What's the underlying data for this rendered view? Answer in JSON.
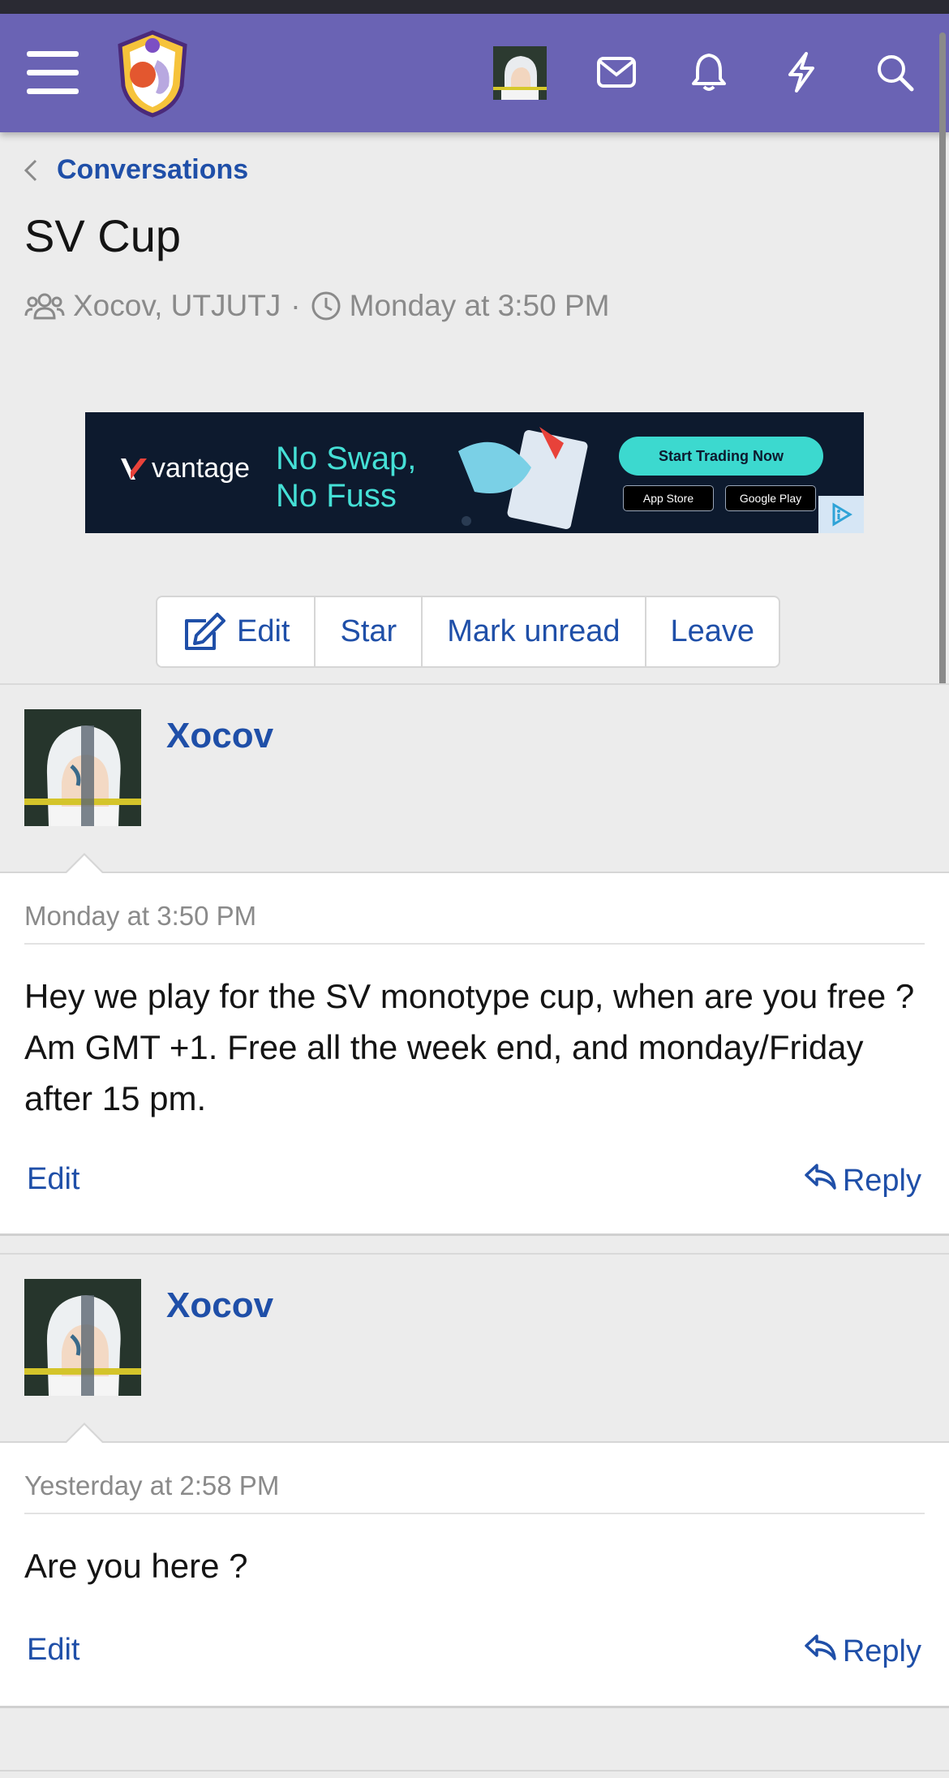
{
  "header": {
    "icons": {
      "menu": "hamburger-menu-icon",
      "logo": "site-logo",
      "avatar": "user-avatar",
      "inbox": "envelope-icon",
      "alerts": "bell-icon",
      "whats_new": "lightning-bolt-icon",
      "search": "search-icon"
    },
    "bar_color": "#6a63b4"
  },
  "breadcrumb": {
    "label": "Conversations"
  },
  "conversation": {
    "title": "SV Cup",
    "participants": "Xocov, UTJUTJ",
    "separator": "·",
    "started": "Monday at 3:50 PM"
  },
  "ad": {
    "brand": "vantage",
    "slogan_line1": "No Swap,",
    "slogan_line2": "No Fuss",
    "cta": "Start Trading Now",
    "store1": "App Store",
    "store2": "Google Play"
  },
  "actions": {
    "edit": "Edit",
    "star": "Star",
    "mark_unread": "Mark unread",
    "leave": "Leave"
  },
  "messages": [
    {
      "author": "Xocov",
      "date": "Monday at 3:50 PM",
      "text": "Hey we play for the SV monotype cup, when are you free ? Am GMT +1. Free all the week end, and monday/Friday after 15 pm.",
      "edit": "Edit",
      "reply": "Reply"
    },
    {
      "author": "Xocov",
      "date": "Yesterday at 2:58 PM",
      "text": "Are you here ?",
      "edit": "Edit",
      "reply": "Reply"
    }
  ],
  "colors": {
    "link": "#1f4fa8",
    "muted": "#8a8a8a",
    "page_bg": "#ececec"
  }
}
